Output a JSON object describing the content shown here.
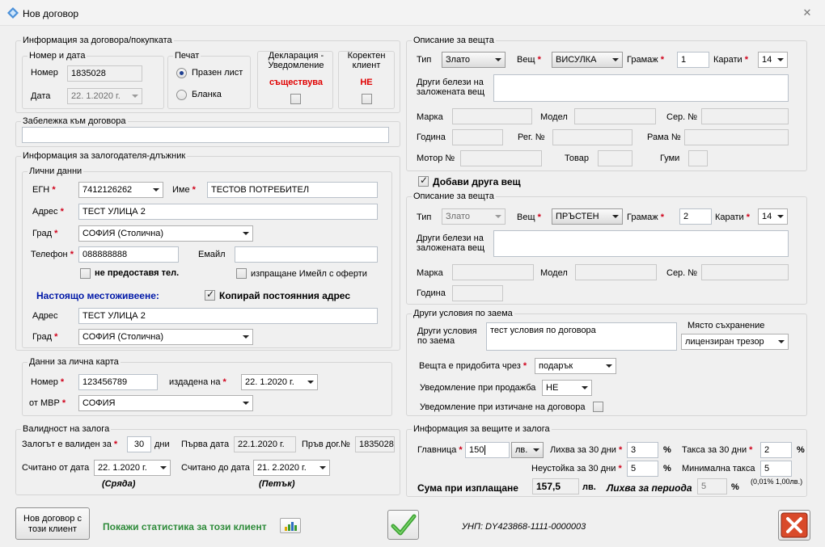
{
  "window": {
    "title": "Нов договор",
    "close_glyph": "✕"
  },
  "contract": {
    "legend": "Информация за договора/покупката",
    "number_date_legend": "Номер и дата",
    "number_label": "Номер",
    "number_value": "1835028",
    "date_label": "Дата",
    "date_value": "22.  1.2020 г.",
    "print_legend": "Печат",
    "print_options": [
      "Празен лист",
      "Бланка"
    ],
    "declaration_legend": "Декларация - Уведомление",
    "declaration_status": "съществува",
    "correct_client_legend": "Коректен клиент",
    "correct_client_status": "НЕ"
  },
  "note": {
    "legend": "Забележка към договора",
    "value": ""
  },
  "pledger": {
    "legend": "Информация за залогодателя-длъжник",
    "personal_legend": "Лични данни",
    "egn_label": "ЕГН",
    "egn_value": "7412126262",
    "name_label": "Име",
    "name_value": "ТЕСТОВ ПОТРЕБИТЕЛ",
    "address_label": "Адрес",
    "address_value": "ТЕСТ УЛИЦА 2",
    "city_label": "Град",
    "city_value": "СОФИЯ  (Столична)",
    "phone_label": "Телефон",
    "phone_value": "088888888",
    "email_label": "Емайл",
    "email_value": "",
    "no_phone_label": "не предоставя тел.",
    "email_offers_label": "изпращане Имейл с оферти",
    "current_residence_label": "Настоящо местоживеене:",
    "copy_address_label": "Копирай постоянния адрес",
    "cur_address_label": "Адрес",
    "cur_address_value": "ТЕСТ УЛИЦА 2",
    "cur_city_label": "Град",
    "cur_city_value": "СОФИЯ  (Столична)"
  },
  "id_card": {
    "legend": "Данни за лична карта",
    "number_label": "Номер",
    "number_value": "123456789",
    "issued_label": "издадена на",
    "issued_value": "22.  1.2020 г.",
    "mvr_label": "от МВР",
    "mvr_value": "СОФИЯ"
  },
  "validity": {
    "legend": "Валидност на залога",
    "valid_for_label": "Залогът е валиден за",
    "valid_for_value": "30",
    "days_label": "дни",
    "first_date_label": "Първа дата",
    "first_date_value": "22.1.2020 г.",
    "prev_contract_label": "Пръв дог.№",
    "prev_contract_value": "1835028",
    "from_date_label": "Считано от дата",
    "from_date_value": "22.  1.2020 г.",
    "to_date_label": "Считано до дата",
    "to_date_value": "21.  2.2020 г.",
    "from_weekday": "(Сряда)",
    "to_weekday": "(Петък)"
  },
  "item1": {
    "legend": "Описание за вещта",
    "type_label": "Тип",
    "type_value": "Злато",
    "item_label": "Вещ",
    "item_value": "ВИСУЛКА",
    "grams_label": "Грамаж",
    "grams_value": "1",
    "karats_label": "Карати",
    "karats_value": "14",
    "other_marks_label": "Други белези на заложената вещ",
    "other_marks_value": "",
    "brand_label": "Марка",
    "model_label": "Модел",
    "serial_label": "Сер. №",
    "year_label": "Година",
    "reg_label": "Рег. №",
    "frame_label": "Рама №",
    "engine_label": "Мотор №",
    "cargo_label": "Товар",
    "tires_label": "Гуми"
  },
  "add_item_label": "Добави друга вещ",
  "item2": {
    "legend": "Описание за вещта",
    "type_label": "Тип",
    "type_value": "Злато",
    "item_label": "Вещ",
    "item_value": "ПРЪСТЕН",
    "grams_label": "Грамаж",
    "grams_value": "2",
    "karats_label": "Карати",
    "karats_value": "14",
    "other_marks_label": "Други белези на заложената вещ",
    "other_marks_value": "",
    "brand_label": "Марка",
    "model_label": "Модел",
    "serial_label": "Сер. №",
    "year_label": "Година"
  },
  "loan_terms": {
    "legend": "Други условия по заема",
    "other_terms_label": "Други условия по заема",
    "other_terms_value": "тест условия по договора",
    "storage_label": "Място съхранение",
    "storage_value": "лицензиран трезор",
    "acquired_label": "Вещта е придобита чрез",
    "acquired_value": "подарък",
    "sale_notify_label": "Уведомление при продажба",
    "sale_notify_value": "НЕ",
    "expiry_notify_label": "Уведомление при изтичане на договора"
  },
  "finance": {
    "legend": "Информация за вещите и залога",
    "principal_label": "Главница",
    "principal_value": "150",
    "currency_value": "лв.",
    "interest_label": "Лихва за 30 дни",
    "interest_value": "3",
    "pct": "%",
    "fee_label": "Такса за 30 дни",
    "fee_value": "2",
    "penalty_label": "Неустойка за 30 дни",
    "penalty_value": "5",
    "min_fee_label": "Минимална такса",
    "min_fee_value": "5",
    "min_fee_note": "(0,01% 1,00лв.)",
    "payout_label": "Сума при изплащане",
    "payout_value": "157,5",
    "payout_currency": "лв.",
    "period_interest_label": "Лихва за периода",
    "period_interest_value": "5"
  },
  "footer": {
    "new_contract_button": "Нов договор с този клиент",
    "stats_link": "Покажи статистика за този клиент",
    "unp_text": "УНП: DY423868-1111-0000003"
  }
}
